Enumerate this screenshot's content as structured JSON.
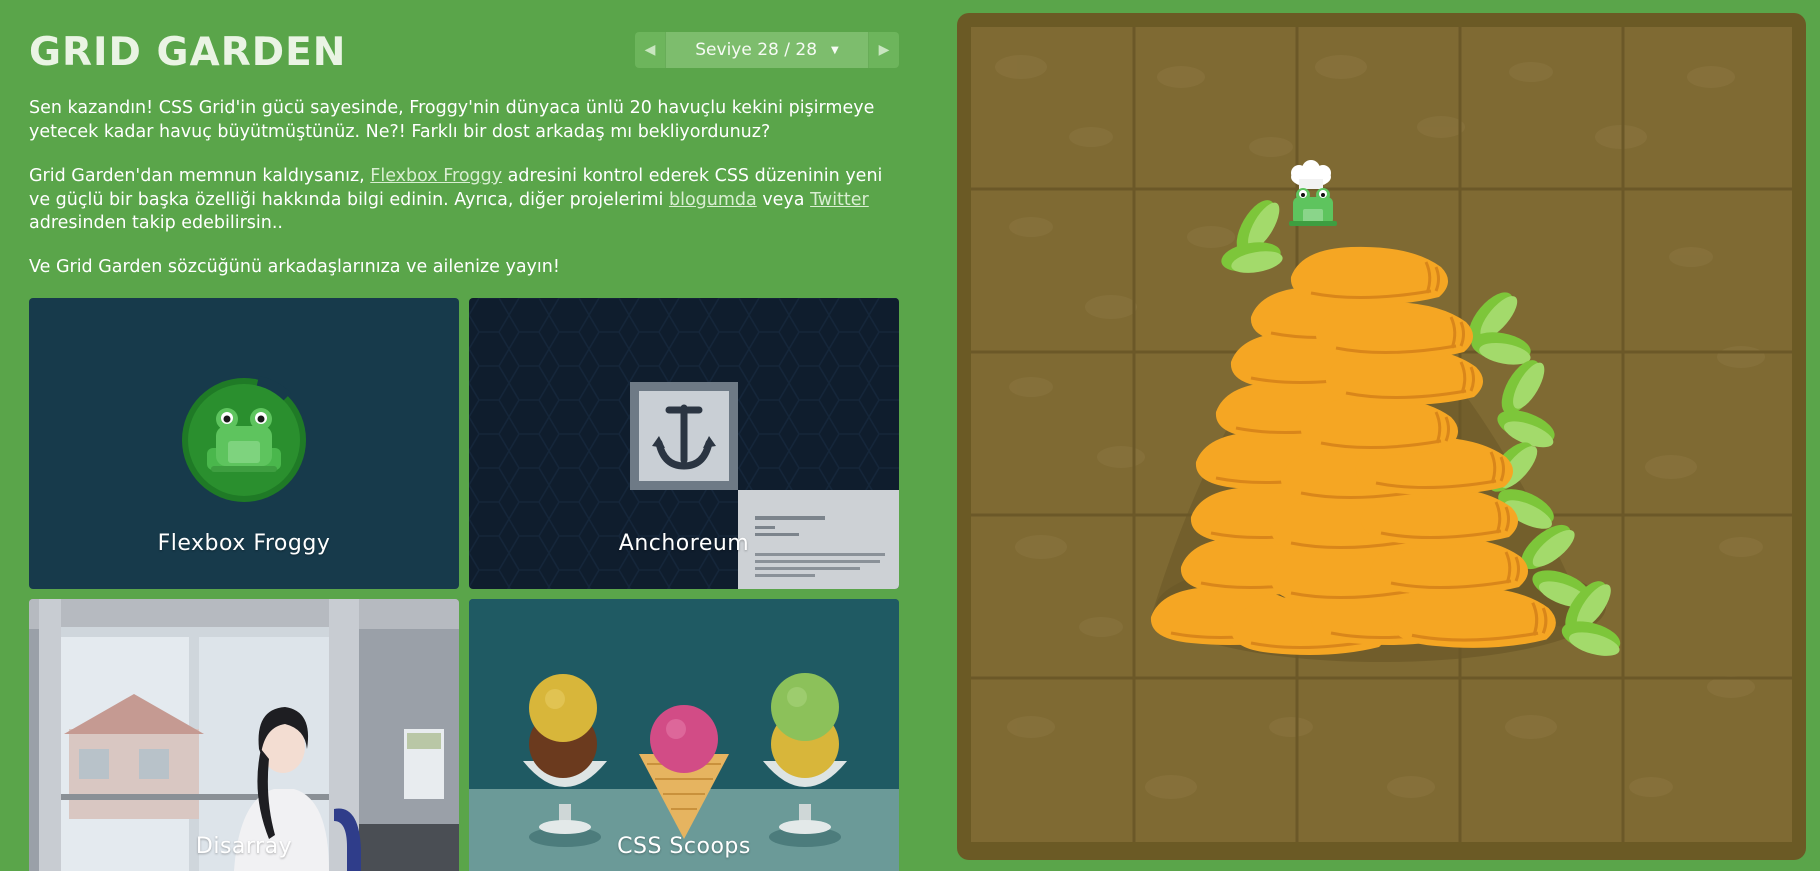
{
  "header": {
    "title": "GRID GARDEN",
    "level_label": "Seviye 28 / 28",
    "prev_arrow": "◀",
    "next_arrow": "▶",
    "caret": "▼"
  },
  "content": {
    "p1": "Sen kazandın! CSS Grid'in gücü sayesinde, Froggy'nin dünyaca ünlü 20 havuçlu kekini pişirmeye yetecek kadar havuç büyütmüştünüz. Ne?! Farklı bir dost arkadaş mı bekliyordunuz?",
    "p2_before": "Grid Garden'dan memnun kaldıysanız, ",
    "p2_link1": "Flexbox Froggy",
    "p2_mid": " adresini kontrol ederek CSS düzeninin yeni ve güçlü bir başka özelliği hakkında bilgi edinin. Ayrıca, diğer projelerimi ",
    "p2_link2": "blogumda",
    "p2_mid2": " veya ",
    "p2_link3": "Twitter",
    "p2_after": " adresinden takip edebilirsin..",
    "p3": "Ve Grid Garden sözcüğünü arkadaşlarınıza ve ailenize yayın!"
  },
  "cards": [
    {
      "label": "Flexbox Froggy"
    },
    {
      "label": "Anchoreum"
    },
    {
      "label": "Disarray"
    },
    {
      "label": "CSS Scoops"
    }
  ],
  "colors": {
    "background": "#5aa54a",
    "garden_border": "#6b5a25",
    "soil": "#7f6a33",
    "carrot": "#f5a623",
    "leaf": "#7dc63a",
    "froggy_card": "#173a4b",
    "anchoreum_card": "#0f1d2d",
    "scoops_card": "#1f5a63"
  },
  "garden": {
    "columns": 5,
    "rows": 5,
    "carrot_count": 20
  }
}
